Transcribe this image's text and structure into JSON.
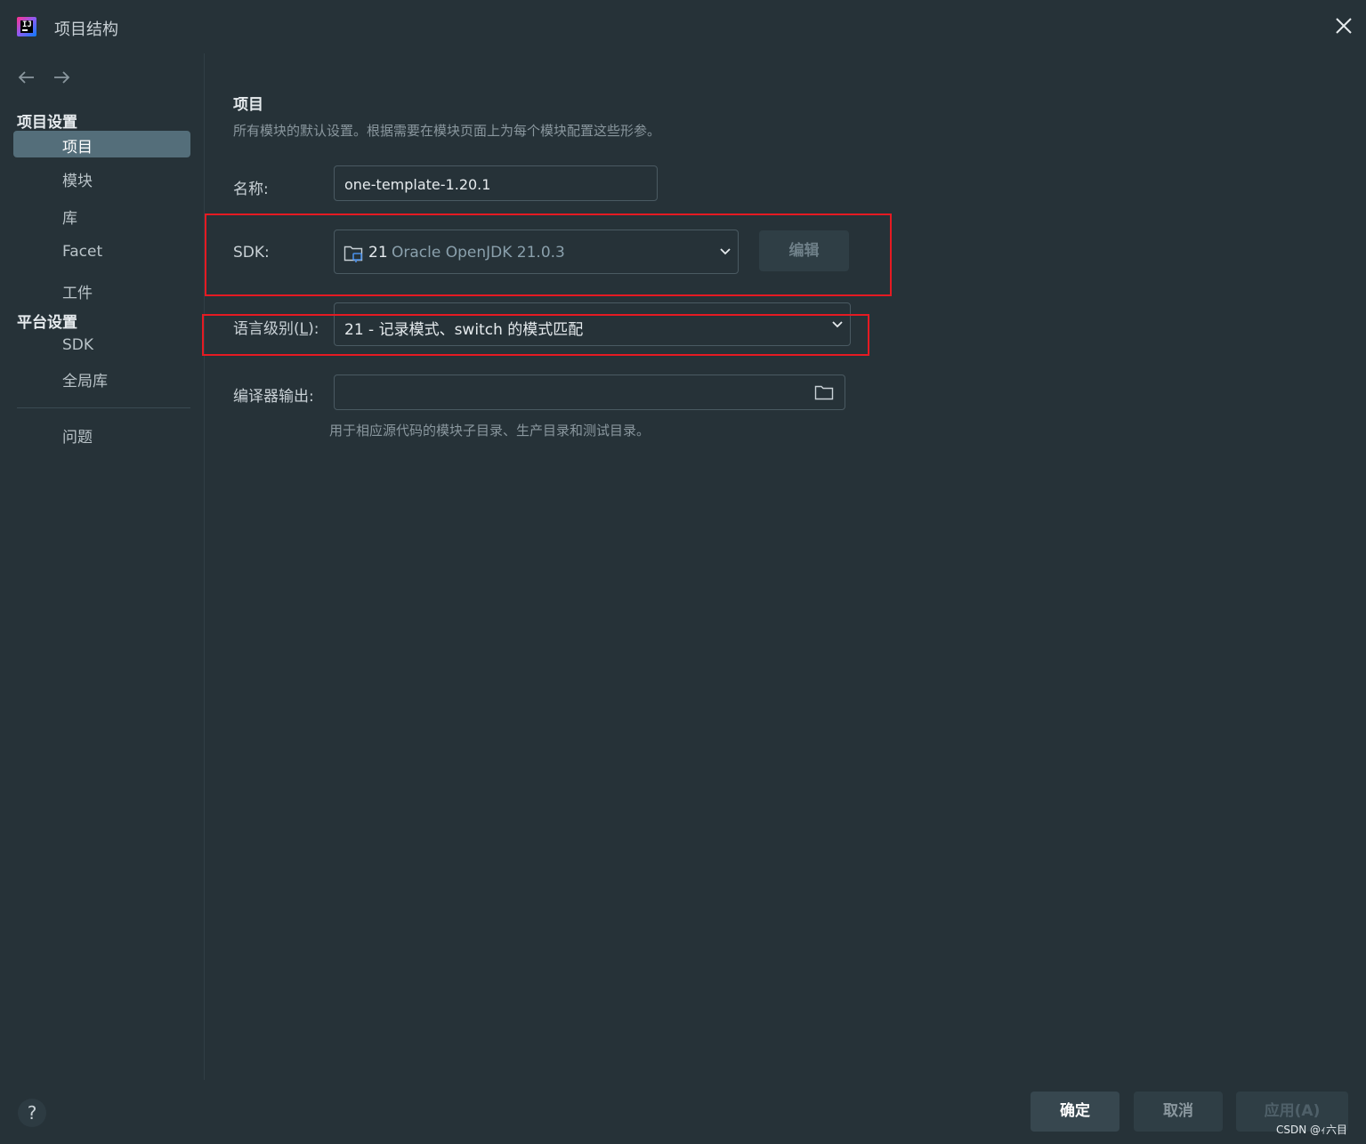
{
  "window": {
    "title": "项目结构"
  },
  "sidebar": {
    "project_settings_header": "项目设置",
    "project_settings_items": [
      {
        "label": "项目",
        "selected": true
      },
      {
        "label": "模块"
      },
      {
        "label": "库"
      },
      {
        "label": "Facet"
      },
      {
        "label": "工件"
      }
    ],
    "platform_settings_header": "平台设置",
    "platform_settings_items": [
      {
        "label": "SDK"
      },
      {
        "label": "全局库"
      }
    ],
    "problems_item": "问题"
  },
  "main": {
    "title": "项目",
    "description": "所有模块的默认设置。根据需要在模块页面上为每个模块配置这些形参。",
    "name_label": "名称:",
    "name_value": "one-template-1.20.1",
    "sdk_label": "SDK:",
    "sdk_version": "21",
    "sdk_name": "Oracle OpenJDK 21.0.3",
    "edit_button": "编辑",
    "language_level_label_prefix": "语言级别(",
    "language_level_mnemonic": "L",
    "language_level_label_suffix": "):",
    "language_level_value": "21 - 记录模式、switch 的模式匹配",
    "compiler_output_label": "编译器输出:",
    "compiler_output_value": "",
    "compiler_output_hint": "用于相应源代码的模块子目录、生产目录和测试目录。"
  },
  "footer": {
    "help": "?",
    "ok": "确定",
    "cancel": "取消",
    "apply": "应用(A)"
  },
  "watermark": "CSDN @ｨ六目",
  "colors": {
    "background": "#263238",
    "selected_item": "#546e7a",
    "annotation": "#e51a22",
    "logo_gradient": [
      "#ff318c",
      "#8a5cf5",
      "#087cfa"
    ]
  }
}
